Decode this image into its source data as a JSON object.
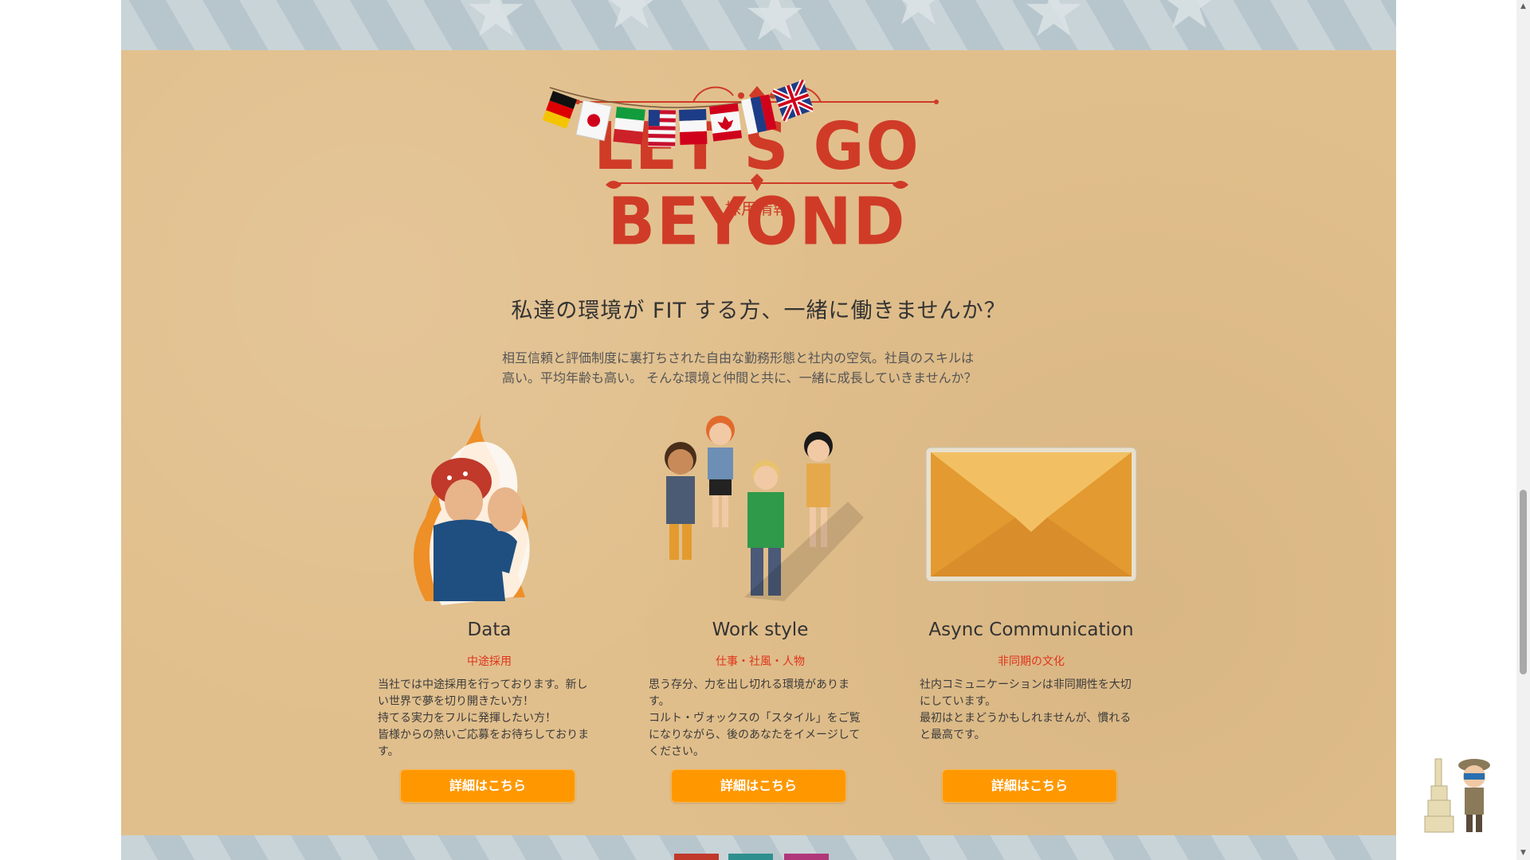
{
  "logo": {
    "title": "LET'S GO BEYOND",
    "subtitle": "採用情報"
  },
  "headline": "私達の環境が FIT する方、一緒に働きませんか？",
  "intro": {
    "line1": "相互信頼と評価制度に裏打ちされた自由な勤務形態と社内の空気。社員のスキルは",
    "line2": "高い。平均年齢も高い。 そんな環境と仲間と共に、一緒に成長していきませんか？"
  },
  "cards": [
    {
      "title": "Data",
      "subtitle": "中途採用",
      "lines": [
        "当社では中途採用を行っております。新し",
        "い世界で夢を切り開きたい方！",
        "持てる実力をフルに発揮したい方！",
        "皆様からの熱いご応募をお待ちしておりま",
        "す。"
      ],
      "button": "詳細はこちら"
    },
    {
      "title": "Work style",
      "subtitle": "仕事・社風・人物",
      "lines": [
        "思う存分、力を出し切れる環境がありま",
        "す。",
        "コルト・ヴォックスの「スタイル」をご覧",
        "になりながら、後のあなたをイメージして",
        "ください。"
      ],
      "button": "詳細はこちら"
    },
    {
      "title": "Async Communication",
      "subtitle": "非同期の文化",
      "lines": [
        "社内コミュニケーションは非同期性を大切",
        "にしています。",
        "最初はとまどうかもしれませんが、慣れる",
        "と最高です。"
      ],
      "button": "詳細はこちら"
    }
  ],
  "colors": {
    "paper": "#e1bf8c",
    "accent_red": "#cf3b27",
    "button_orange": "#ff9800",
    "band_blue_gray": "#c9d4d8"
  },
  "icons": {
    "flags": "flag-bunting-icon",
    "card1": "rosie-worker-illustration",
    "card2": "group-people-illustration",
    "card3": "envelope-illustration",
    "mascot": "explorer-mascot-icon"
  }
}
